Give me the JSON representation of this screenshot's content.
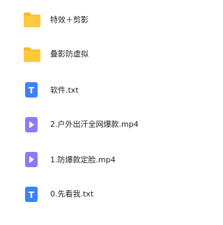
{
  "files": [
    {
      "name": "特效＋剪影",
      "icon": "folder-icon",
      "type": "folder"
    },
    {
      "name": "叠影防虚拟",
      "icon": "folder-icon",
      "type": "folder"
    },
    {
      "name": "软件.txt",
      "icon": "text-file-icon",
      "type": "txt"
    },
    {
      "name": "2.户外出汗全网爆款.mp4",
      "icon": "video-file-icon",
      "type": "mp4"
    },
    {
      "name": "1.防爆款定脸.mp4",
      "icon": "video-file-icon",
      "type": "mp4"
    },
    {
      "name": "0.先看我.txt",
      "icon": "text-file-icon",
      "type": "txt"
    }
  ],
  "colors": {
    "folder": "#FFC93C",
    "folder_tab": "#F5B82E",
    "text_file": "#3B82F6",
    "video_file": "#8B7CF6"
  }
}
